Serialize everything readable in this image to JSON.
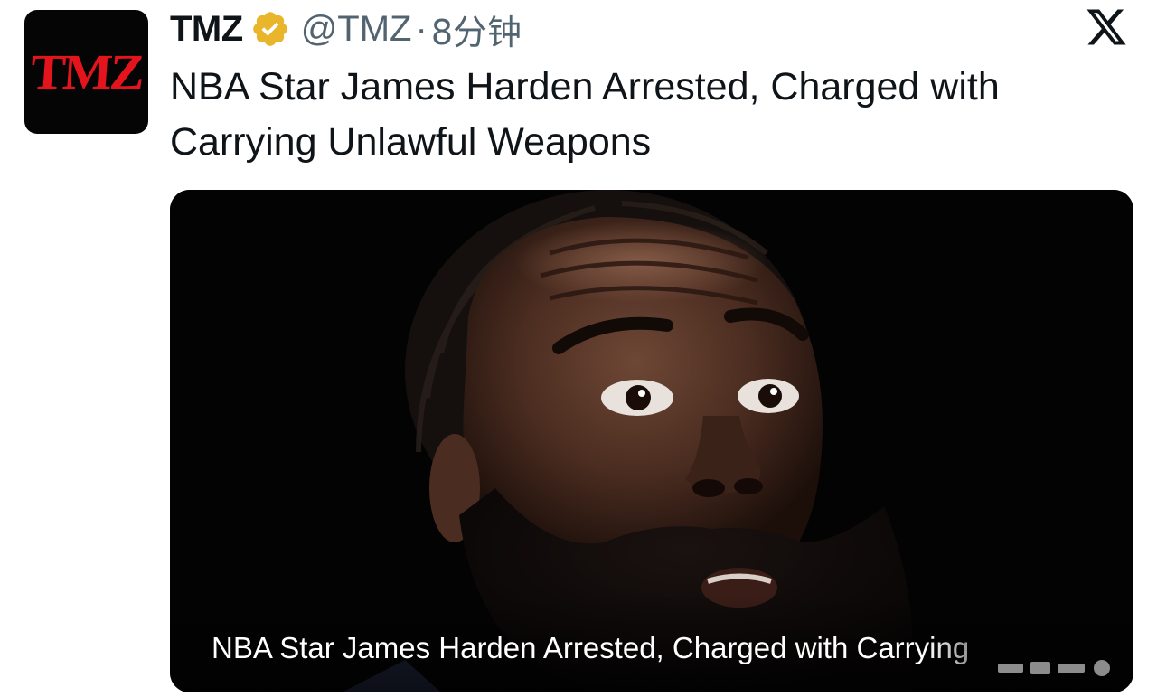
{
  "tweet": {
    "avatar": {
      "logo_text": "TMZ",
      "background": "#050505",
      "text_color": "#e3141b"
    },
    "display_name": "TMZ",
    "verified_badge": {
      "icon": "verified-gold-badge-icon",
      "color": "#e8b52b"
    },
    "handle": "@TMZ",
    "separator": "·",
    "timestamp": "8分钟",
    "platform_icon": "x-logo-icon",
    "headline": "NBA Star James Harden Arrested, Charged with Carrying Unlawful Weapons",
    "media": {
      "caption": "NBA Star James Harden Arrested, Charged with Carrying",
      "subject": "close-up photo of bearded basketball player with surprised expression",
      "background": "#030303"
    }
  },
  "colors": {
    "text_primary": "#0f1419",
    "text_secondary": "#536471",
    "page_background": "#ffffff"
  }
}
